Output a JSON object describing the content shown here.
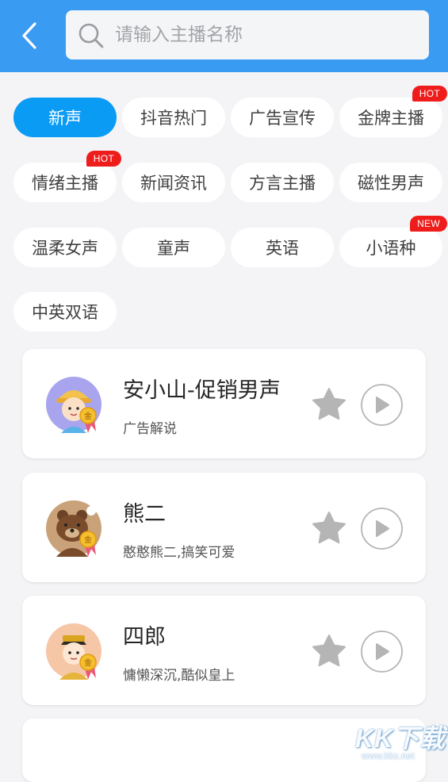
{
  "search": {
    "placeholder": "请输入主播名称",
    "value": ""
  },
  "categories": [
    {
      "label": "新声",
      "active": true,
      "badge": ""
    },
    {
      "label": "抖音热门",
      "active": false,
      "badge": ""
    },
    {
      "label": "广告宣传",
      "active": false,
      "badge": ""
    },
    {
      "label": "金牌主播",
      "active": false,
      "badge": "HOT"
    },
    {
      "label": "情绪主播",
      "active": false,
      "badge": "HOT"
    },
    {
      "label": "新闻资讯",
      "active": false,
      "badge": ""
    },
    {
      "label": "方言主播",
      "active": false,
      "badge": ""
    },
    {
      "label": "磁性男声",
      "active": false,
      "badge": ""
    },
    {
      "label": "温柔女声",
      "active": false,
      "badge": ""
    },
    {
      "label": "童声",
      "active": false,
      "badge": ""
    },
    {
      "label": "英语",
      "active": false,
      "badge": ""
    },
    {
      "label": "小语种",
      "active": false,
      "badge": "NEW"
    },
    {
      "label": "中英双语",
      "active": false,
      "badge": ""
    }
  ],
  "anchors": [
    {
      "name": "安小山-促销男声",
      "desc": "广告解说",
      "avatar_icon": "cartoon-boy-avatar-icon",
      "medal": "金"
    },
    {
      "name": "熊二",
      "desc": "憨憨熊二,搞笑可爱",
      "avatar_icon": "bear-avatar-icon",
      "medal": "金"
    },
    {
      "name": "四郎",
      "desc": "慵懒深沉,酷似皇上",
      "avatar_icon": "emperor-avatar-icon",
      "medal": "金"
    }
  ],
  "watermark": {
    "logo_text": "KK下载",
    "url": "www.kkx.net"
  },
  "colors": {
    "header": "#3a9bf3",
    "active_chip": "#0a9bf5",
    "badge": "#ef1c1c",
    "icon_gray": "#b5b5b5",
    "background": "#f4f4f6"
  }
}
